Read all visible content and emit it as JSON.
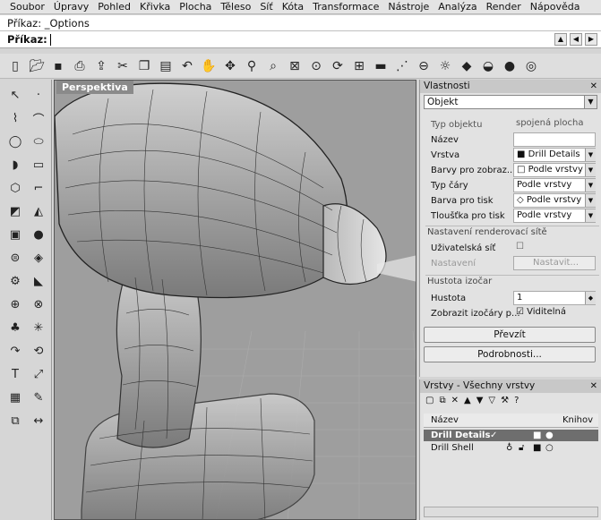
{
  "menu": [
    "Soubor",
    "Úpravy",
    "Pohled",
    "Křivka",
    "Plocha",
    "Těleso",
    "Síť",
    "Kóta",
    "Transformace",
    "Nástroje",
    "Analýza",
    "Render",
    "Nápověda"
  ],
  "command": {
    "history": "Příkaz: _Options",
    "prompt": "Příkaz:"
  },
  "toolbar_icons": [
    "new-file-icon",
    "open-icon",
    "save-icon",
    "print-icon",
    "export-icon",
    "cut-icon",
    "copy-icon",
    "paste-icon",
    "undo-icon",
    "pan-hand-icon",
    "rotate-view-icon",
    "zoom-icon",
    "zoom-window-icon",
    "zoom-extents-icon",
    "zoom-selected-icon",
    "rotate-icon",
    "viewport-layout-icon",
    "car-icon",
    "grid-snap-icon",
    "osnap-icon",
    "lightbulb-icon",
    "render-icon",
    "shade-icon",
    "sphere-icon",
    "material-icon"
  ],
  "viewport": {
    "title": "Perspektiva"
  },
  "properties": {
    "title": "Vlastnosti",
    "selector": "Objekt",
    "type_label": "Typ objektu",
    "type_value": "spojená plocha",
    "rows": [
      {
        "label": "Název",
        "value": ""
      },
      {
        "label": "Vrstva",
        "value": "Drill Details"
      },
      {
        "label": "Barvy pro zobraz...",
        "value": "Podle vrstvy"
      },
      {
        "label": "Typ čáry",
        "value": "Podle vrstvy"
      },
      {
        "label": "Barva pro tisk",
        "value": "Podle vrstvy"
      },
      {
        "label": "Tloušťka pro tisk",
        "value": "Podle vrstvy"
      }
    ],
    "mesh_section": "Nastavení renderovací sítě",
    "custom_mesh_label": "Uživatelská síť",
    "settings_label": "Nastavení",
    "settings_button": "Nastavit...",
    "iso_section": "Hustota izočar",
    "density_label": "Hustota",
    "density_value": "1",
    "show_iso_label": "Zobrazit izočáry p...",
    "show_iso_value": "Viditelná",
    "match_button": "Převzít",
    "details_button": "Podrobnosti..."
  },
  "layers": {
    "title": "Vrstvy - Všechny vrstvy",
    "col_name": "Název",
    "col_library": "Knihov",
    "rows": [
      {
        "name": "Drill Details",
        "check": "✓",
        "selected": true
      },
      {
        "name": "Drill Shell",
        "selected": false
      }
    ]
  }
}
